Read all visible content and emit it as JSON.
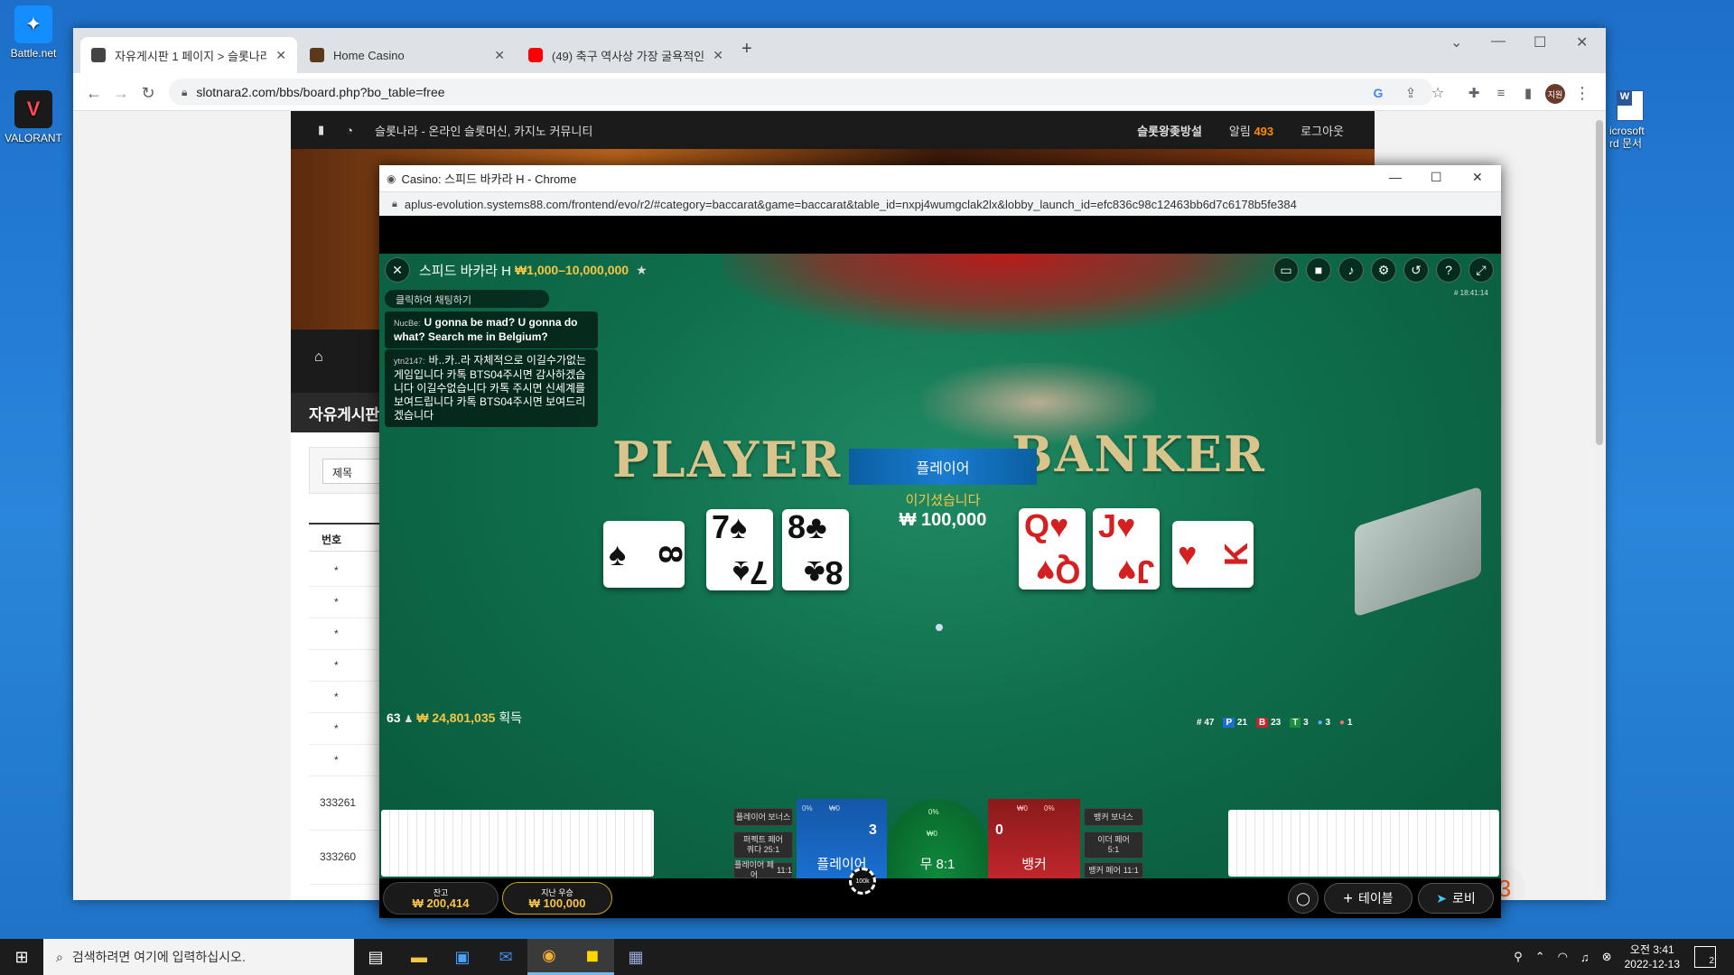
{
  "desktop": {
    "icons": [
      {
        "label": "Battle.net",
        "icon": "battlenet-icon"
      },
      {
        "label": "VALORANT",
        "icon": "valorant-icon"
      }
    ],
    "word_doc_label_1": "icrosoft",
    "word_doc_label_2": "rd 문서"
  },
  "browser": {
    "tabs": [
      {
        "title": "자유게시판 1 페이지 > 슬롯나라",
        "icon": "site-favicon",
        "active": true
      },
      {
        "title": "Home Casino",
        "icon": "casino-favicon",
        "active": false
      },
      {
        "title": "(49) 축구 역사상 가장 굴욕적인",
        "icon": "youtube-icon",
        "active": false
      }
    ],
    "new_tab": "+",
    "url": "slotnara2.com/bbs/board.php?bo_table=free",
    "profile": "지원"
  },
  "site": {
    "nav_title": "슬롯나라 - 온라인 슬롯머신, 카지노 커뮤니티",
    "nav_right": {
      "link1": "슬롯왕좆방설",
      "alarm_label": "알림",
      "alarm_count": "493",
      "logout": "로그아웃"
    },
    "board_title": "자유게시판",
    "search_select": "제목",
    "col_number": "번호",
    "pinned_rows": [
      "*",
      "*",
      "*",
      "*",
      "*",
      "*",
      "*"
    ],
    "rows": [
      "333261",
      "333260"
    ],
    "right_badge": "3"
  },
  "popup": {
    "title": "Casino: 스피드 바카라 H - Chrome",
    "url": "aplus-evolution.systems88.com/frontend/evo/r2/#category=baccarat&game=baccarat&table_id=nxpj4wumgclak2lx&lobby_launch_id=efc836c98c12463bb6d7c6178b5fe384"
  },
  "game": {
    "table_name": "스피드 바카라 H",
    "limits": "₩1,000–10,000,000",
    "round_id": "# 18:41:14",
    "chat_prompt": "클릭하여 채팅하기",
    "chat": [
      {
        "user": "NucBe:",
        "text": "U gonna be mad? U gonna do what? Search me in Belgium?"
      },
      {
        "user": "ytn2147:",
        "text": "바..카..라 자체적으로 이길수가없는게임입니다 카톡 BTS04주시면 감사하겠습니다 이길수없습니다 카톡 주시면 신세계를 보여드립니다 카톡 BTS04주시면 보여드리겠습니다"
      }
    ],
    "felt_player": "PLAYER",
    "felt_banker": "BANKER",
    "result_label": "플레이어",
    "win_text": "이기셨습니다",
    "win_amount": "₩ 100,000",
    "player_cards": [
      {
        "rank": "8",
        "suit": "♠",
        "color": "black",
        "side": true
      },
      {
        "rank": "7",
        "suit": "♠",
        "color": "black",
        "side": false
      },
      {
        "rank": "8",
        "suit": "♣",
        "color": "black",
        "side": false
      }
    ],
    "banker_cards": [
      {
        "rank": "Q",
        "suit": "♥",
        "color": "red",
        "side": false
      },
      {
        "rank": "J",
        "suit": "♥",
        "color": "red",
        "side": false
      },
      {
        "rank": "K",
        "suit": "♥",
        "color": "red",
        "side": true
      }
    ],
    "winners": {
      "count": "63",
      "amount": "₩ 24,801,035",
      "suffix": "획득"
    },
    "stats": {
      "round": "# 47",
      "player": "21",
      "banker": "23",
      "tie": "3",
      "p_pair": "3",
      "b_pair": "1"
    },
    "bets": {
      "player_bonus": "플레이어 보너스",
      "perfect_pair": "퍼펙트 페어",
      "perfect_pair_odds": "쿼다 25:1",
      "player_pair": "플레이어 페어",
      "player_pair_odds": "11:1",
      "player_label": "플레이어",
      "player_score": "3",
      "player_pct": "0%",
      "player_amount": "₩0",
      "tie_label": "무 8:1",
      "tie_pct": "0%",
      "tie_amount": "₩0",
      "banker_label": "뱅커",
      "banker_score": "0",
      "banker_pct": "0%",
      "banker_amount": "₩0",
      "banker_bonus": "뱅커 보너스",
      "either_pair": "이더 페어",
      "either_pair_odds": "5:1",
      "banker_pair": "뱅커 페어",
      "banker_pair_odds": "11:1"
    },
    "chip_value": "100k",
    "balance_label": "잔고",
    "balance": "₩ 200,414",
    "last_win_label": "지난 우승",
    "last_win": "₩ 100,000",
    "btn_table": "테이블",
    "btn_lobby": "로비"
  },
  "taskbar": {
    "search_placeholder": "검색하려면 여기에 입력하십시오.",
    "time": "오전 3:41",
    "date": "2022-12-13",
    "notif_count": "2"
  },
  "colors": {
    "accent_gold": "#f6c544",
    "player_blue": "#1a6fd0",
    "banker_red": "#c0262b",
    "felt_green": "#0f6e4c"
  }
}
